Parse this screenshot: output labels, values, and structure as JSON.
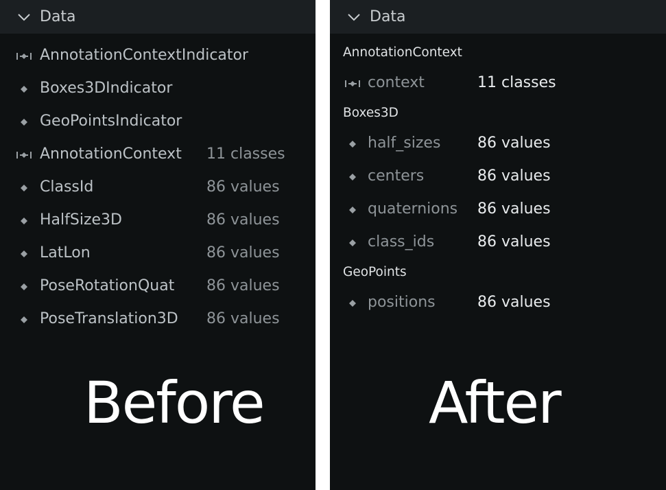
{
  "before": {
    "header": {
      "title": "Data",
      "icon": "chevron-down-icon"
    },
    "rows": [
      {
        "name": "AnnotationContextIndicator",
        "value": "",
        "icon": "indicator-icon"
      },
      {
        "name": "Boxes3DIndicator",
        "value": "",
        "icon": "diamond-icon"
      },
      {
        "name": "GeoPointsIndicator",
        "value": "",
        "icon": "diamond-icon"
      },
      {
        "name": "AnnotationContext",
        "value": "11 classes",
        "icon": "indicator-icon"
      },
      {
        "name": "ClassId",
        "value": "86 values",
        "icon": "diamond-icon"
      },
      {
        "name": "HalfSize3D",
        "value": "86 values",
        "icon": "diamond-icon"
      },
      {
        "name": "LatLon",
        "value": "86 values",
        "icon": "diamond-icon"
      },
      {
        "name": "PoseRotationQuat",
        "value": "86 values",
        "icon": "diamond-icon"
      },
      {
        "name": "PoseTranslation3D",
        "value": "86 values",
        "icon": "diamond-icon"
      }
    ],
    "caption": "Before"
  },
  "after": {
    "header": {
      "title": "Data",
      "icon": "chevron-down-icon"
    },
    "groups": [
      {
        "label": "AnnotationContext",
        "rows": [
          {
            "name": "context",
            "value": "11 classes",
            "icon": "indicator-icon"
          }
        ]
      },
      {
        "label": "Boxes3D",
        "rows": [
          {
            "name": "half_sizes",
            "value": "86 values",
            "icon": "diamond-icon"
          },
          {
            "name": "centers",
            "value": "86 values",
            "icon": "diamond-icon"
          },
          {
            "name": "quaternions",
            "value": "86 values",
            "icon": "diamond-icon"
          },
          {
            "name": "class_ids",
            "value": "86 values",
            "icon": "diamond-icon"
          }
        ]
      },
      {
        "label": "GeoPoints",
        "rows": [
          {
            "name": "positions",
            "value": "86 values",
            "icon": "diamond-icon"
          }
        ]
      }
    ],
    "caption": "After"
  },
  "colors": {
    "panel_bg": "#0e1112",
    "header_bg": "#1b1f22",
    "text_primary": "#e8ebed",
    "text_muted": "#8e9498",
    "icon": "#9aa0a4"
  }
}
